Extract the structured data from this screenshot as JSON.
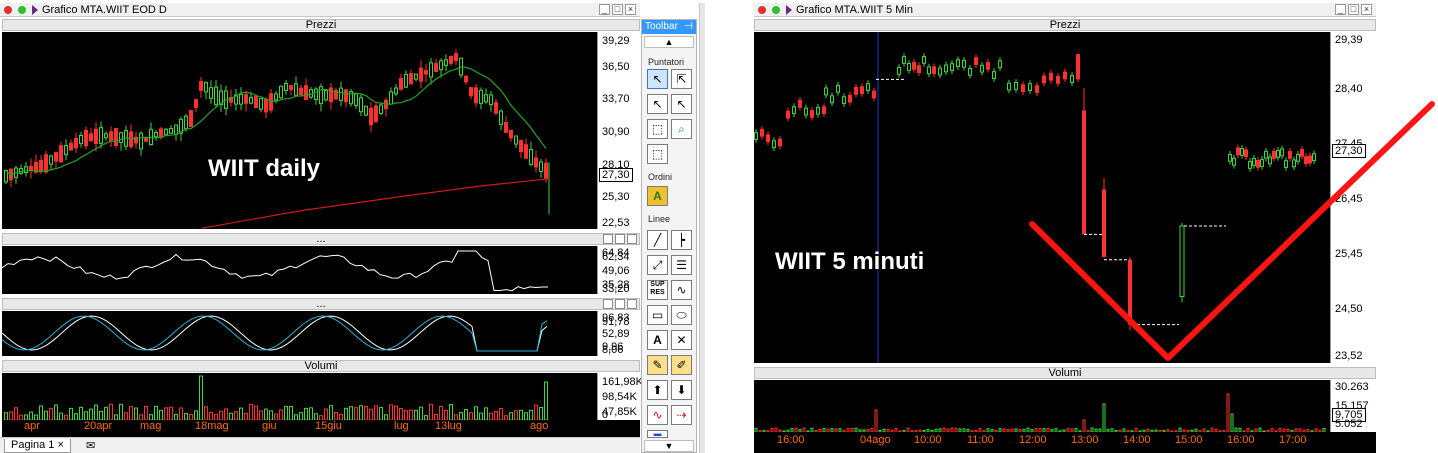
{
  "left_window": {
    "title": "Grafico MTA.WIIT EOD D",
    "overlay_text": "WIIT daily",
    "price_panel": {
      "title": "Prezzi",
      "scale": [
        "39,29",
        "36,50",
        "33,70",
        "30,90",
        "28,10",
        "25,30",
        "22,53"
      ],
      "current_price": "27,30"
    },
    "osc1_panel": {
      "title": "...",
      "scale": [
        "64,84",
        "62,34",
        "49,06",
        "35,28",
        "33,20"
      ]
    },
    "osc2_panel": {
      "title": "...",
      "scale": [
        "96,83",
        "91,78",
        "52,89",
        "9,96",
        "8,06"
      ]
    },
    "volume_panel": {
      "title": "Volumi",
      "scale": [
        "161,98K",
        "98,54K",
        "47,85K",
        "0"
      ]
    },
    "x_labels": [
      "apr",
      "20apr",
      "mag",
      "18mag",
      "giu",
      "15giu",
      "lug",
      "13lug",
      "ago"
    ],
    "tab": "Pagina 1"
  },
  "toolbar": {
    "title": "Toolbar",
    "sections": [
      "Puntatori",
      "Ordini",
      "Linee"
    ],
    "tools": [
      "pointer-arrow",
      "pointer-cross",
      "pointer-arrow-2",
      "pointer-arrow-3",
      "pointer-select",
      "zoom",
      "area-select",
      "order",
      "line",
      "horizontal-line",
      "trend-arrow",
      "channel",
      "support-resistance",
      "curve",
      "rectangle",
      "ellipse",
      "text",
      "cross-delete",
      "pencil",
      "eraser",
      "arrow-up",
      "arrow-down",
      "wave",
      "delete-all"
    ],
    "sup_res_label": "SUP\nRES",
    "up_arrow": "▲",
    "down_arrow": "▼"
  },
  "right_window": {
    "title": "Grafico MTA.WIIT 5 Min",
    "overlay_text": "WIIT 5 minuti",
    "price_panel": {
      "title": "Prezzi",
      "scale": [
        "29,39",
        "28,40",
        "27,45",
        "26,45",
        "25,45",
        "24,50",
        "23,52"
      ],
      "current_price": "27,30"
    },
    "volume_panel": {
      "title": "Volumi",
      "scale": [
        "30.263",
        "15.157",
        "9.705",
        "5.052"
      ],
      "current_volume": "9,705"
    },
    "x_labels": [
      "16:00",
      "04ago",
      "10:00",
      "11:00",
      "12:00",
      "13:00",
      "14:00",
      "15:00",
      "16:00",
      "17:00"
    ]
  },
  "colors": {
    "chart_bg": "#000000",
    "bull_candle": "#3cd93c",
    "bear_candle": "#ff3030",
    "ma_short": "#1fa51f",
    "ma_long": "#cc1a1a",
    "osc_line": "#ffffff",
    "osc_line_2": "#27b4d8",
    "annotation_v": "#ff1414",
    "x_axis_text": "#ff6a00"
  }
}
